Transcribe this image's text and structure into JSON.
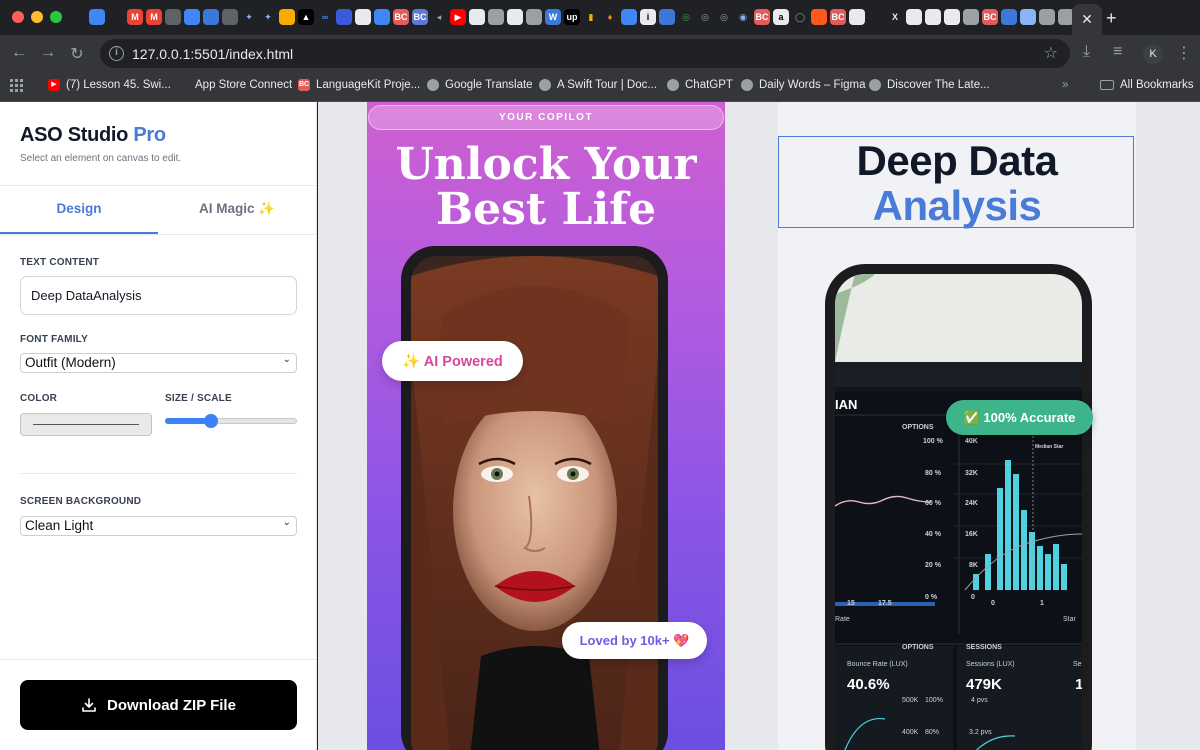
{
  "browser": {
    "url": "127.0.0.1:5501/index.html",
    "profile_initial": "K",
    "bookmarks": [
      {
        "label": "(7) Lesson 45. Swi...",
        "icon": "youtube-icon",
        "color": "#ff0000"
      },
      {
        "label": "App Store Connect",
        "icon": "apple-icon",
        "color": "#9aa0a6"
      },
      {
        "label": "LanguageKit Proje...",
        "icon": "languagekit-icon",
        "color": "#e25c5c"
      },
      {
        "label": "Google Translate",
        "icon": "globe-icon",
        "color": "#9aa0a6"
      },
      {
        "label": "A Swift Tour | Doc...",
        "icon": "globe-icon",
        "color": "#9aa0a6"
      },
      {
        "label": "ChatGPT",
        "icon": "chatgpt-icon",
        "color": "#9aa0a6"
      },
      {
        "label": "Daily Words – Figma",
        "icon": "globe-icon",
        "color": "#9aa0a6"
      },
      {
        "label": "Discover The Late...",
        "icon": "globe-icon",
        "color": "#9aa0a6"
      }
    ],
    "all_bookmarks": "All Bookmarks"
  },
  "sidebar": {
    "brand": "ASO Studio",
    "brand_accent": "Pro",
    "subtitle": "Select an element on canvas to edit.",
    "tabs": {
      "design": "Design",
      "ai": "AI Magic ✨"
    },
    "text_content_label": "TEXT CONTENT",
    "text_content_value": "Deep DataAnalysis",
    "font_family_label": "FONT FAMILY",
    "font_family_value": "Outfit (Modern)",
    "color_label": "COLOR",
    "size_label": "SIZE / SCALE",
    "size_value": 0.35,
    "bg_label": "SCREEN BACKGROUND",
    "bg_value": "Clean Light",
    "download_label": "Download ZIP File"
  },
  "canvas": {
    "shot1": {
      "pill": "YOUR COPILOT",
      "headline_line1": "Unlock Your",
      "headline_line2": "Best Life",
      "badge_ai": "✨ AI Powered",
      "badge_loved": "Loved by 10k+ 💖"
    },
    "shot2": {
      "headline_line1": "Deep Data",
      "headline_line2": "Analysis",
      "badge": "✅ 100% Accurate",
      "dash": {
        "mean_label": "IAN",
        "options": "OPTIONS",
        "pct_ticks": [
          "100 %",
          "80 %",
          "60 %",
          "40 %",
          "20 %",
          "0 %"
        ],
        "k_ticks": [
          "40K",
          "32K",
          "24K",
          "16K",
          "8K",
          "0"
        ],
        "x_ticks_left": [
          "15",
          "17.5"
        ],
        "x_ticks_right": [
          "0",
          "1"
        ],
        "median": "Median Star",
        "rate_label": "Rate",
        "star_label": "Star",
        "bounce_label": "Bounce Rate (LUX)",
        "bounce_value": "40.6%",
        "sessions_header": "SESSIONS",
        "sessions_label": "Sessions (LUX)",
        "sessions_value": "479K",
        "sessions_sub": "4 pvs",
        "sessions_sub2": "3.2 pvs",
        "small_ticks": [
          "500K",
          "100%",
          "400K",
          "80%"
        ],
        "extra_s": "Se",
        "extra_1": "1"
      }
    }
  }
}
